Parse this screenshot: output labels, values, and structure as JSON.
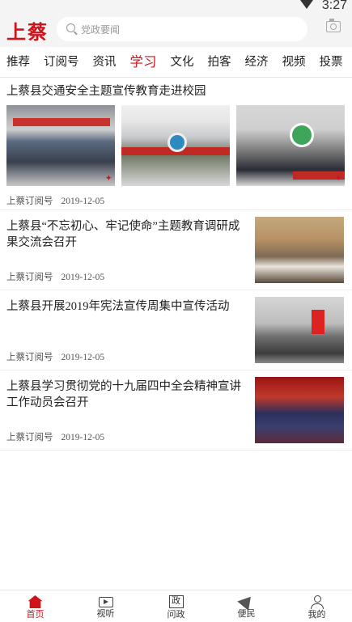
{
  "status_bar": {
    "time": "3:27"
  },
  "header": {
    "logo_text": "上蔡",
    "search_placeholder": "党政要闻",
    "accent_color": "#d0121b"
  },
  "tabs": [
    {
      "label": "推荐",
      "active": false
    },
    {
      "label": "订阅号",
      "active": false
    },
    {
      "label": "资讯",
      "active": false
    },
    {
      "label": "学习",
      "active": true
    },
    {
      "label": "文化",
      "active": false
    },
    {
      "label": "拍客",
      "active": false
    },
    {
      "label": "经济",
      "active": false
    },
    {
      "label": "视频",
      "active": false
    },
    {
      "label": "投票",
      "active": false
    }
  ],
  "feature": {
    "title": "上蔡县交通安全主题宣传教育走进校园",
    "source": "上蔡订阅号",
    "date": "2019-12-05"
  },
  "articles": [
    {
      "title": "上蔡县“不忘初心、牢记使命”主题教育调研成果交流会召开",
      "source": "上蔡订阅号",
      "date": "2019-12-05"
    },
    {
      "title": "上蔡县开展2019年宪法宣传周集中宣传活动",
      "source": "上蔡订阅号",
      "date": "2019-12-05"
    },
    {
      "title": "上蔡县学习贯彻党的十九届四中全会精神宣讲工作动员会召开",
      "source": "上蔡订阅号",
      "date": "2019-12-05"
    }
  ],
  "bottom_nav": [
    {
      "label": "首页",
      "icon": "home-icon",
      "active": true
    },
    {
      "label": "视听",
      "icon": "tv-icon",
      "active": false
    },
    {
      "label": "问政",
      "icon": "zheng-icon",
      "glyph": "政",
      "active": false
    },
    {
      "label": "便民",
      "icon": "send-icon",
      "active": false
    },
    {
      "label": "我的",
      "icon": "user-icon",
      "active": false
    }
  ]
}
